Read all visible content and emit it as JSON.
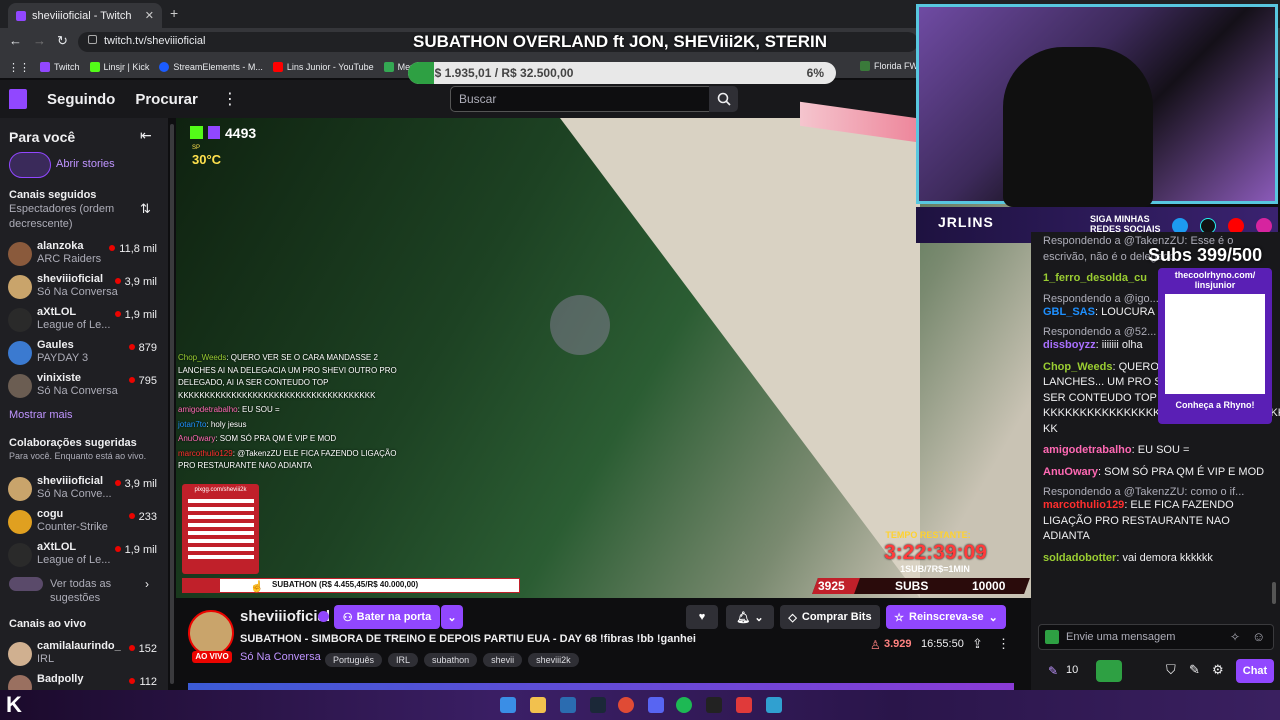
{
  "browser": {
    "tab_title": "sheviiioficial - Twitch",
    "url": "twitch.tv/sheviiioficial",
    "bookmarks": [
      "Twitch",
      "Linsjr | Kick",
      "StreamElements - M...",
      "Lins Junior - YouTube",
      "Meu Drive",
      "Florida FWC"
    ]
  },
  "nav": {
    "seguindo": "Seguindo",
    "procurar": "Procurar",
    "search_placeholder": "Buscar"
  },
  "overlay": {
    "title": "SUBATHON OVERLAND ft JON, SHEViii2K, STERIN",
    "money": "R$ 1.935,01 / R$ 32.500,00",
    "money_pct": "6%",
    "kick_count": "4493",
    "weather_label": "SP",
    "weather_temp": "30°C",
    "timer_label": "TEMPO RESTANTE:",
    "timer": "3:22:39:09",
    "timer_rule": "1SUB/7R$=1MIN",
    "subs_current": "3925",
    "subs_label": "SUBS",
    "subs_goal": "10000",
    "subathon_bar": "SUBATHON (R$ 4.455,45/R$ 40.000,00)",
    "pix_url": "pixgg.com/sheviii2k",
    "cam_brand": "JRLINS",
    "cam_social": "SIGA MINHAS REDES SOCIAIS",
    "cam_subs": "Subs 399/500",
    "cam_qr_url": "thecoolrhyno.com/ linsjunior",
    "cam_qr_caption": "Conheça a Rhyno!"
  },
  "overlay_chat": [
    {
      "user": "Chop_Weeds",
      "text": ": QUERO VER SE O CARA MANDASSE 2 LANCHES AI NA DELEGACIA UM PRO SHEVI OUTRO PRO DELEGADO, AI IA SER CONTEUDO TOP KKKKKKKKKKKKKKKKKKKKKKKKKKKKKKKKKKKKK"
    },
    {
      "user": "amigodetrabalho",
      "text": ": EU SOU ="
    },
    {
      "user": "jotan7to",
      "text": ": holy jesus"
    },
    {
      "user": "AnuOwary",
      "text": ": SOM SÓ PRA QM É VIP E MOD"
    },
    {
      "user": "marcothulio129",
      "text": ": @TakenzZU ELE FICA FAZENDO LIGAÇÃO PRO RESTAURANTE NAO ADIANTA"
    }
  ],
  "sidebar": {
    "header": "Para você",
    "stories": "Abrir stories",
    "followed_title": "Canais seguidos",
    "followed_sort": "Espectadores (ordem decrescente)",
    "followed": [
      {
        "name": "alanzoka",
        "game": "ARC Raiders",
        "viewers": "11,8 mil",
        "color": "#8a5a3c"
      },
      {
        "name": "sheviiioficial",
        "game": "Só Na Conversa",
        "viewers": "3,9 mil",
        "color": "#c9a46b"
      },
      {
        "name": "aXtLOL",
        "game": "League of Le...",
        "viewers": "1,9 mil",
        "color": "#2a2a2a"
      },
      {
        "name": "Gaules",
        "game": "PAYDAY 3",
        "viewers": "879",
        "color": "#3b7ad0"
      },
      {
        "name": "vinixiste",
        "game": "Só Na Conversa",
        "viewers": "795",
        "color": "#6b5d52"
      }
    ],
    "show_more": "Mostrar mais",
    "collab_title": "Colaborações sugeridas",
    "collab_sub": "Para você. Enquanto está ao vivo.",
    "collabs": [
      {
        "name": "sheviiioficial",
        "game": "Só Na Conve...",
        "viewers": "3,9 mil",
        "color": "#c9a46b"
      },
      {
        "name": "cogu",
        "game": "Counter-Strike",
        "viewers": "233",
        "color": "#e0a020"
      },
      {
        "name": "aXtLOL",
        "game": "League of Le...",
        "viewers": "1,9 mil",
        "color": "#2a2a2a"
      }
    ],
    "see_all": "Ver todas as sugestões",
    "live_title": "Canais ao vivo",
    "live": [
      {
        "name": "camilalaurindo_",
        "game": "IRL",
        "viewers": "152",
        "color": "#d0b090"
      },
      {
        "name": "Badpolly",
        "game": "",
        "viewers": "112",
        "color": "#9a7060"
      }
    ]
  },
  "stream": {
    "channel": "sheviiioficial",
    "knock": "Bater na porta",
    "title": "SUBATHON - SIMBORA DE TREINO E DEPOIS PARTIU EUA - DAY 68 !fibras !bb !ganhei",
    "live_badge": "AO VIVO",
    "category": "Só Na Conversa",
    "tags": [
      "Português",
      "IRL",
      "subathon",
      "shevii",
      "sheviii2k"
    ],
    "viewers": "3.929",
    "uptime": "16:55:50",
    "buy_bits": "Comprar Bits",
    "resub": "Reinscreva-se"
  },
  "chat": {
    "lines": [
      {
        "kind": "reply",
        "text": "Respondendo a @TakenzZU: Esse é o escrivão, não é o delegado"
      },
      {
        "kind": "msg",
        "user": "1_ferro_desolda_cu",
        "color": "#9acd32",
        "text": ""
      },
      {
        "kind": "reply",
        "text": "Respondendo a @igo..."
      },
      {
        "kind": "msg",
        "user": "GBL_SAS",
        "color": "#1e90ff",
        "text": ": LOUCURA"
      },
      {
        "kind": "reply",
        "text": "Respondendo a @52..."
      },
      {
        "kind": "msg",
        "user": "dissboyzz",
        "color": "#a970ff",
        "text": ": iiiiiii olha"
      },
      {
        "kind": "msg",
        "user": "Chop_Weeds",
        "color": "#9acd32",
        "text": ": QUERO V... MANDASSE 2 LANCHES... UM PRO SHEVI OUTRO... IA SER CONTEUDO TOP KKKKKKKKKKKKKKKKKKKKKKKKKKKKKKKKKKK KK"
      },
      {
        "kind": "msg",
        "user": "amigodetrabalho",
        "color": "#ff69b4",
        "text": ": EU SOU ="
      },
      {
        "kind": "msg",
        "user": "AnuOwary",
        "color": "#ff69b4",
        "text": ": SOM SÓ PRA QM É VIP E MOD"
      },
      {
        "kind": "reply",
        "text": "Respondendo a @TakenzZU: como o if..."
      },
      {
        "kind": "msg",
        "user": "marcothulio129",
        "color": "#ff2e2e",
        "text": ": ELE FICA FAZENDO LIGAÇÃO PRO RESTAURANTE NAO ADIANTA"
      },
      {
        "kind": "msg",
        "user": "soldadobotter",
        "color": "#9acd32",
        "text": ": vai demora kkkkkk"
      }
    ],
    "input_placeholder": "Envie uma mensagem",
    "points": "10",
    "chat_button": "Chat"
  },
  "colors": {
    "accent": "#9147ff",
    "live_red": "#eb0400"
  }
}
